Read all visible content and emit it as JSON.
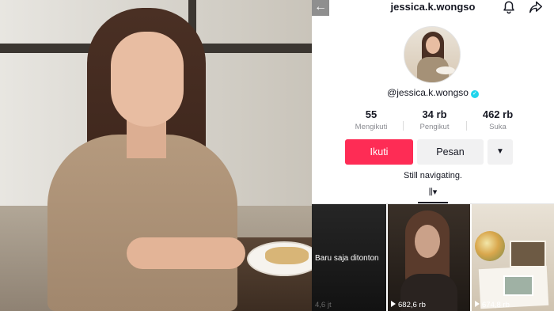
{
  "profile": {
    "username": "jessica.k.wongso",
    "handle": "@jessica.k.wongso",
    "bio": "Still navigating.",
    "verified": true
  },
  "icons": {
    "back": "back-arrow-icon",
    "notifications": "bell-icon",
    "share": "share-icon",
    "verified": "verified-check-icon",
    "more": "caret-down-icon",
    "videos_tab": "grid-columns-icon",
    "play": "play-icon"
  },
  "stats": [
    {
      "value": "55",
      "label": "Mengikuti"
    },
    {
      "value": "34 rb",
      "label": "Pengikut"
    },
    {
      "value": "462 rb",
      "label": "Suka"
    }
  ],
  "actions": {
    "follow_label": "Ikuti",
    "message_label": "Pesan",
    "more_symbol": "▼"
  },
  "tabs": {
    "videos_symbol": "⫼▾"
  },
  "videos": [
    {
      "badge": "Baru saja ditonton",
      "views": "4,6 jt"
    },
    {
      "views": "682,6 rb"
    },
    {
      "views": "674,8 rb"
    }
  ],
  "colors": {
    "follow_button": "#fe2c55",
    "secondary_button": "#f1f1f2",
    "verified_badge": "#20d5ec",
    "text_primary": "#161823",
    "text_secondary": "#8a8b91"
  }
}
